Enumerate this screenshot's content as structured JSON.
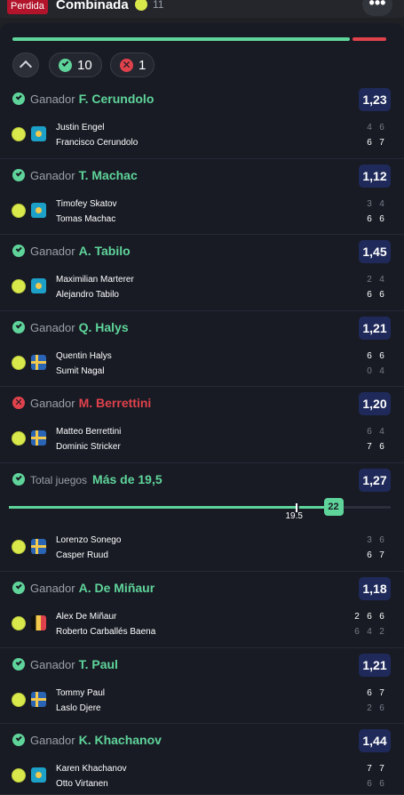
{
  "header": {
    "status_badge": "Perdida",
    "title": "Combinada",
    "sport_count": "11",
    "more_label": "•••"
  },
  "summary": {
    "won_count": "10",
    "lost_count": "1",
    "colors": {
      "won": "#5fd49a",
      "lost": "#e0424c"
    }
  },
  "selections": [
    {
      "result": "won",
      "market": "Ganador",
      "pick": "F. Cerundolo",
      "odds": "1,23",
      "flag": "kz",
      "players": [
        {
          "name": "Justin Engel",
          "scores": [
            "4",
            "6"
          ],
          "winner": false
        },
        {
          "name": "Francisco Cerundolo",
          "scores": [
            "6",
            "7"
          ],
          "winner": true
        }
      ]
    },
    {
      "result": "won",
      "market": "Ganador",
      "pick": "T. Machac",
      "odds": "1,12",
      "flag": "kz",
      "players": [
        {
          "name": "Timofey Skatov",
          "scores": [
            "3",
            "4"
          ],
          "winner": false
        },
        {
          "name": "Tomas Machac",
          "scores": [
            "6",
            "6"
          ],
          "winner": true
        }
      ]
    },
    {
      "result": "won",
      "market": "Ganador",
      "pick": "A. Tabilo",
      "odds": "1,45",
      "flag": "kz",
      "players": [
        {
          "name": "Maximilian Marterer",
          "scores": [
            "2",
            "4"
          ],
          "winner": false
        },
        {
          "name": "Alejandro Tabilo",
          "scores": [
            "6",
            "6"
          ],
          "winner": true
        }
      ]
    },
    {
      "result": "won",
      "market": "Ganador",
      "pick": "Q. Halys",
      "odds": "1,21",
      "flag": "se",
      "players": [
        {
          "name": "Quentin Halys",
          "scores": [
            "6",
            "6"
          ],
          "winner": true
        },
        {
          "name": "Sumit Nagal",
          "scores": [
            "0",
            "4"
          ],
          "winner": false
        }
      ]
    },
    {
      "result": "lost",
      "market": "Ganador",
      "pick": "M. Berrettini",
      "odds": "1,20",
      "flag": "se",
      "players": [
        {
          "name": "Matteo Berrettini",
          "scores": [
            "6",
            "4"
          ],
          "winner": false
        },
        {
          "name": "Dominic Stricker",
          "scores": [
            "7",
            "6"
          ],
          "winner": true
        }
      ]
    },
    {
      "result": "won",
      "market": "Total juegos",
      "pick": "Más de 19,5",
      "odds": "1,27",
      "flag": "se",
      "line_label": "19.5",
      "actual_total": "22",
      "line_fraction": 0.75,
      "actual_fraction": 0.85,
      "players": [
        {
          "name": "Lorenzo Sonego",
          "scores": [
            "3",
            "6"
          ],
          "winner": false
        },
        {
          "name": "Casper Ruud",
          "scores": [
            "6",
            "7"
          ],
          "winner": true
        }
      ]
    },
    {
      "result": "won",
      "market": "Ganador",
      "pick": "A. De Miñaur",
      "odds": "1,18",
      "flag": "be",
      "players": [
        {
          "name": "Alex De Miñaur",
          "scores": [
            "2",
            "6",
            "6"
          ],
          "winner": true
        },
        {
          "name": "Roberto Carballés Baena",
          "scores": [
            "6",
            "4",
            "2"
          ],
          "winner": false
        }
      ]
    },
    {
      "result": "won",
      "market": "Ganador",
      "pick": "T. Paul",
      "odds": "1,21",
      "flag": "se",
      "players": [
        {
          "name": "Tommy Paul",
          "scores": [
            "6",
            "7"
          ],
          "winner": true
        },
        {
          "name": "Laslo Djere",
          "scores": [
            "2",
            "6"
          ],
          "winner": false
        }
      ]
    },
    {
      "result": "won",
      "market": "Ganador",
      "pick": "K. Khachanov",
      "odds": "1,44",
      "flag": "kz",
      "players": [
        {
          "name": "Karen Khachanov",
          "scores": [
            "7",
            "7"
          ],
          "winner": true
        },
        {
          "name": "Otto Virtanen",
          "scores": [
            "6",
            "6"
          ],
          "winner": false
        }
      ]
    }
  ]
}
